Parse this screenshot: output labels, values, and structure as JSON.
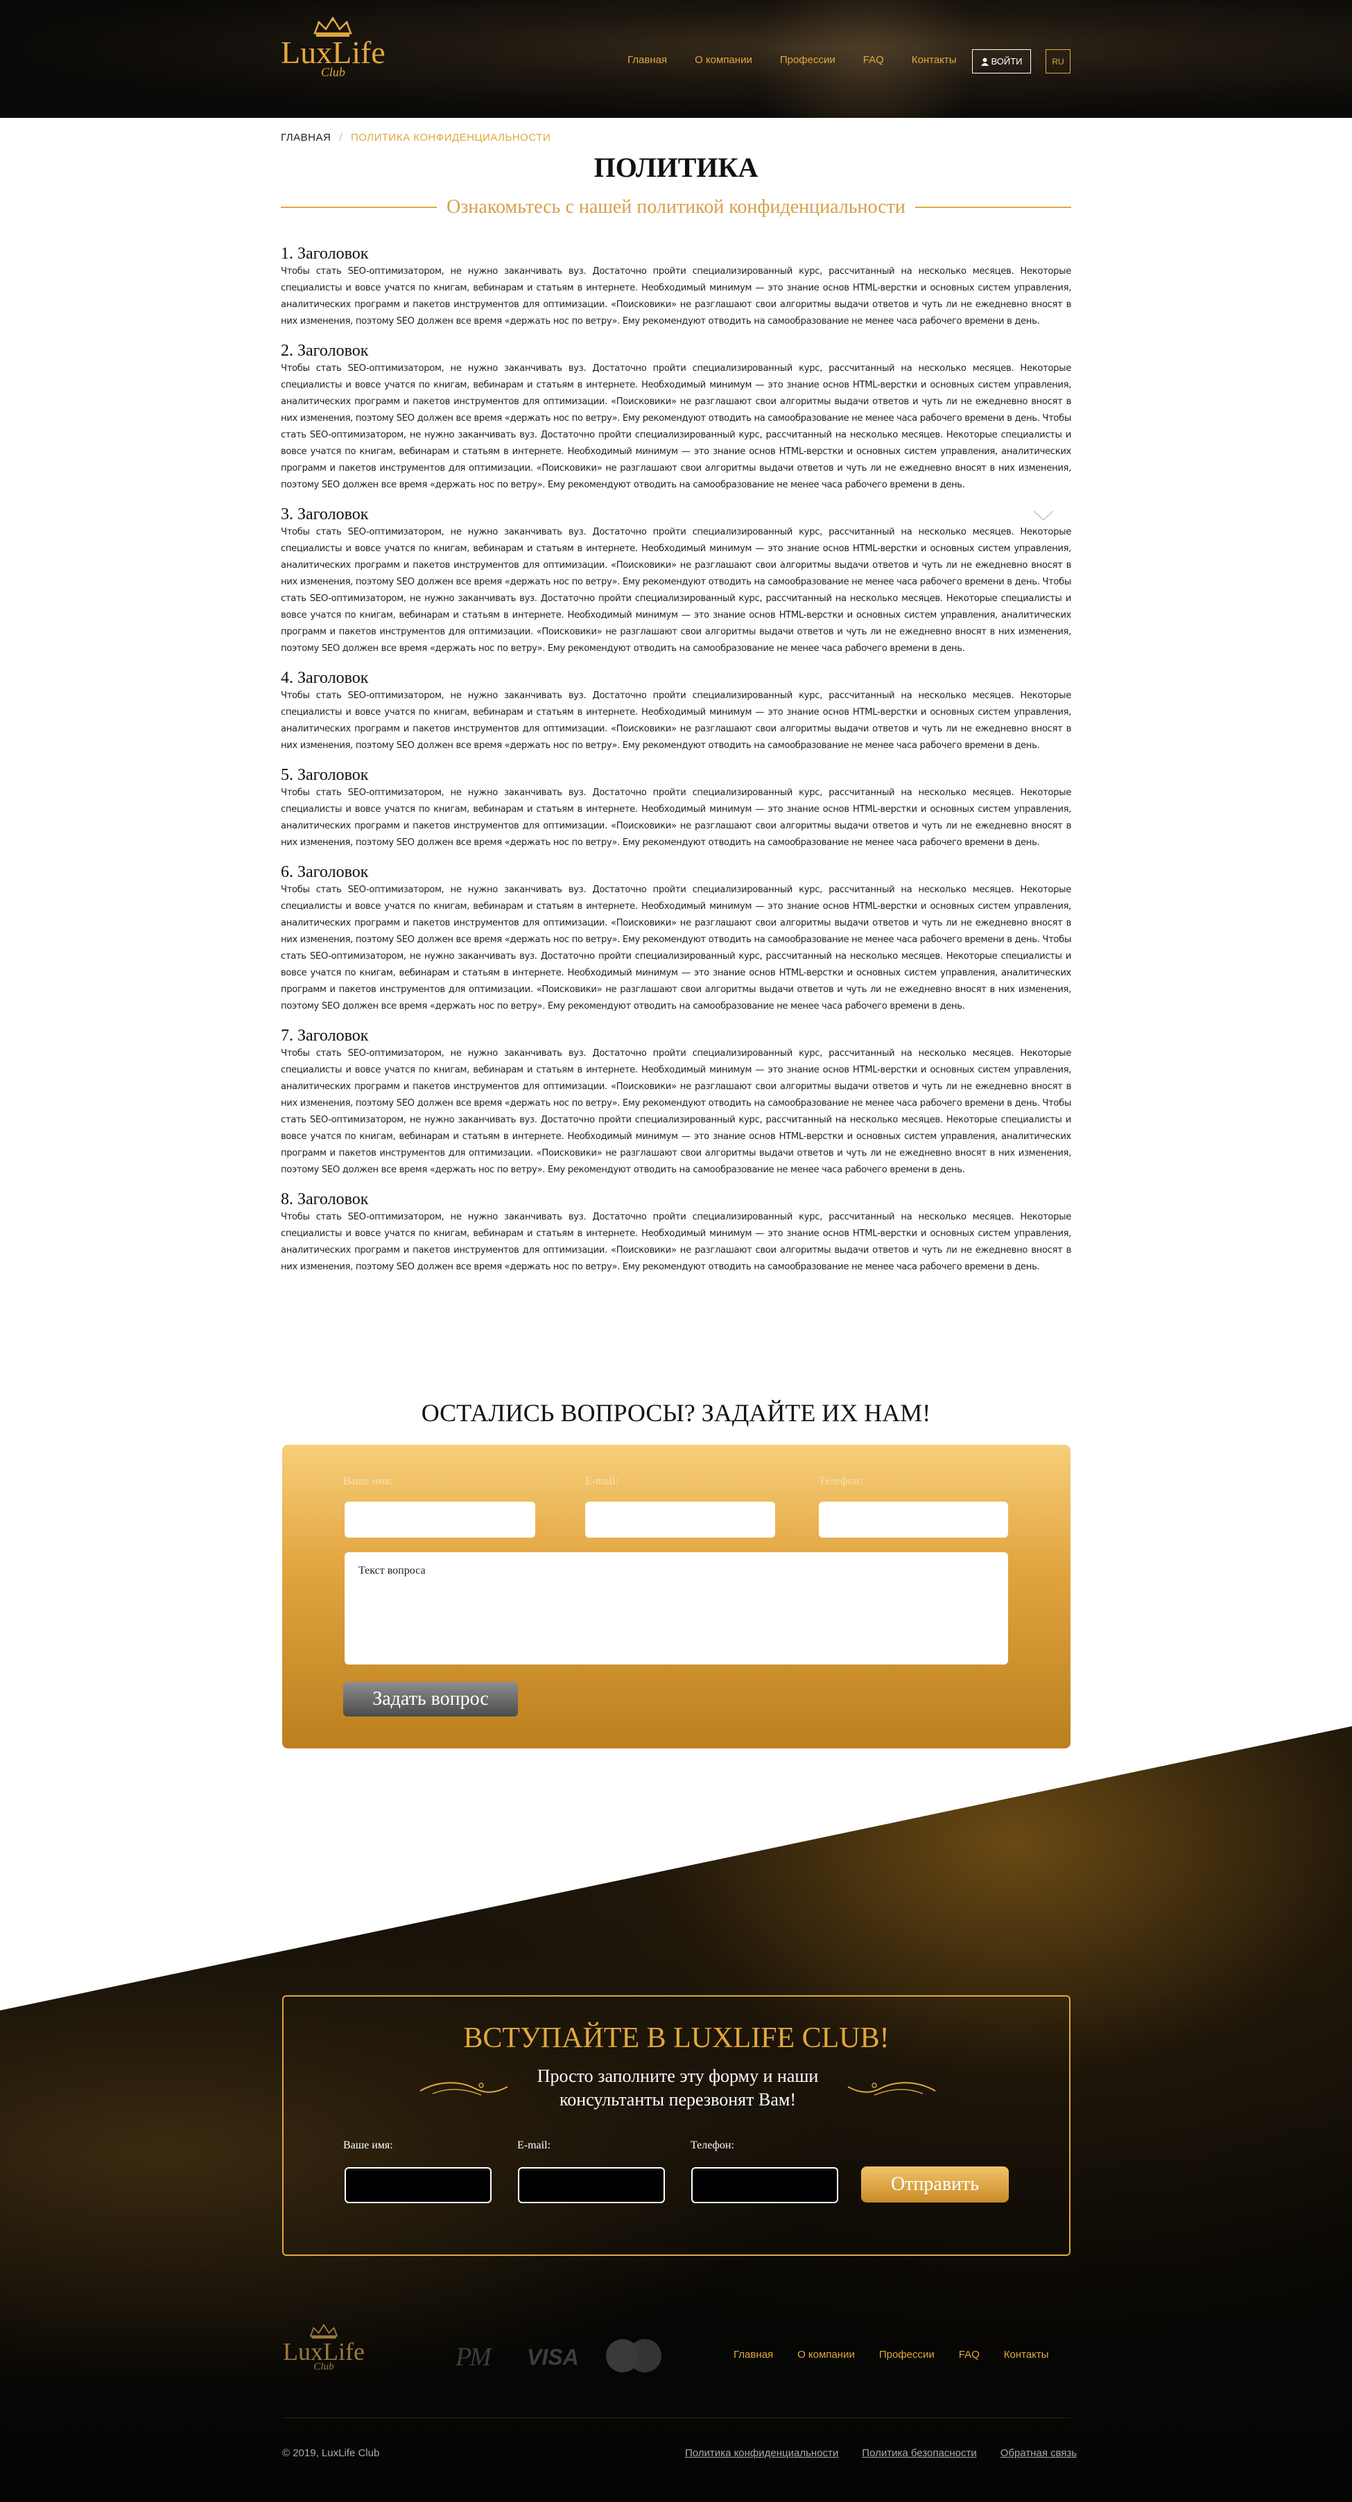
{
  "header": {
    "logo_word": "LuxLife",
    "logo_sub": "Club",
    "nav": [
      "Главная",
      "О компании",
      "Профессии",
      "FAQ",
      "Контакты"
    ],
    "login_label": "ВОЙТИ",
    "lang_label": "RU"
  },
  "breadcrumb": {
    "home": "ГЛАВНАЯ",
    "separator": "/",
    "current": "ПОЛИТИКА КОНФИДЕНЦИАЛЬНОСТИ"
  },
  "page": {
    "title": "ПОЛИТИКА",
    "subtitle": "Ознакомьтесь с нашей политикой конфиденциальности"
  },
  "sections": [
    {
      "heading": "1. Заголовок",
      "text": "Чтобы стать SEO-оптимизатором, не нужно заканчивать вуз. Достаточно пройти специализированный курс, рассчитанный на несколько месяцев. Некоторые специалисты и вовсе учатся по книгам, вебинарам и статьям в интернете. Необходимый минимум — это знание основ HTML-верстки и основных систем управления, аналитических программ и пакетов инструментов для оптимизации. «Поисковики» не разглашают свои алгоритмы выдачи ответов и чуть ли не ежедневно вносят в них изменения, поэтому SEO должен все время «держать нос по ветру». Ему рекомендуют отводить на самообразование не менее часа рабочего времени в день."
    },
    {
      "heading": "2. Заголовок",
      "text": "Чтобы стать SEO-оптимизатором, не нужно заканчивать вуз. Достаточно пройти специализированный курс, рассчитанный на несколько месяцев. Некоторые специалисты и вовсе учатся по книгам, вебинарам и статьям в интернете. Необходимый минимум — это знание основ HTML-верстки и основных систем управления, аналитических программ и пакетов инструментов для оптимизации. «Поисковики» не разглашают свои алгоритмы выдачи ответов и чуть ли не ежедневно вносят в них изменения, поэтому SEO должен все время «держать нос по ветру». Ему рекомендуют отводить на самообразование не менее часа рабочего времени в день. Чтобы стать SEO-оптимизатором, не нужно заканчивать вуз. Достаточно пройти специализированный курс, рассчитанный на несколько месяцев. Некоторые специалисты и вовсе учатся по книгам, вебинарам и статьям в интернете. Необходимый минимум — это знание основ HTML-верстки и основных систем управления, аналитических программ и пакетов инструментов для оптимизации. «Поисковики» не разглашают свои алгоритмы выдачи ответов и чуть ли не ежедневно вносят в них изменения, поэтому SEO должен все время «держать нос по ветру». Ему рекомендуют отводить на самообразование не менее часа рабочего времени в день."
    },
    {
      "heading": "3. Заголовок",
      "text": "Чтобы стать SEO-оптимизатором, не нужно заканчивать вуз. Достаточно пройти специализированный курс, рассчитанный на несколько месяцев. Некоторые специалисты и вовсе учатся по книгам, вебинарам и статьям в интернете. Необходимый минимум — это знание основ HTML-верстки и основных систем управления, аналитических программ и пакетов инструментов для оптимизации. «Поисковики» не разглашают свои алгоритмы выдачи ответов и чуть ли не ежедневно вносят в них изменения, поэтому SEO должен все время «держать нос по ветру». Ему рекомендуют отводить на самообразование не менее часа рабочего времени в день. Чтобы стать SEO-оптимизатором, не нужно заканчивать вуз. Достаточно пройти специализированный курс, рассчитанный на несколько месяцев. Некоторые специалисты и вовсе учатся по книгам, вебинарам и статьям в интернете. Необходимый минимум — это знание основ HTML-верстки и основных систем управления, аналитических программ и пакетов инструментов для оптимизации. «Поисковики» не разглашают свои алгоритмы выдачи ответов и чуть ли не ежедневно вносят в них изменения, поэтому SEO должен все время «держать нос по ветру». Ему рекомендуют отводить на самообразование не менее часа рабочего времени в день."
    },
    {
      "heading": "4. Заголовок",
      "text": "Чтобы стать SEO-оптимизатором, не нужно заканчивать вуз. Достаточно пройти специализированный курс, рассчитанный на несколько месяцев. Некоторые специалисты и вовсе учатся по книгам, вебинарам и статьям в интернете. Необходимый минимум — это знание основ HTML-верстки и основных систем управления, аналитических программ и пакетов инструментов для оптимизации. «Поисковики» не разглашают свои алгоритмы выдачи ответов и чуть ли не ежедневно вносят в них изменения, поэтому SEO должен все время «держать нос по ветру». Ему рекомендуют отводить на самообразование не менее часа рабочего времени в день."
    },
    {
      "heading": "5. Заголовок",
      "text": "Чтобы стать SEO-оптимизатором, не нужно заканчивать вуз. Достаточно пройти специализированный курс, рассчитанный на несколько месяцев. Некоторые специалисты и вовсе учатся по книгам, вебинарам и статьям в интернете. Необходимый минимум — это знание основ HTML-верстки и основных систем управления, аналитических программ и пакетов инструментов для оптимизации. «Поисковики» не разглашают свои алгоритмы выдачи ответов и чуть ли не ежедневно вносят в них изменения, поэтому SEO должен все время «держать нос по ветру». Ему рекомендуют отводить на самообразование не менее часа рабочего времени в день."
    },
    {
      "heading": "6. Заголовок",
      "text": "Чтобы стать SEO-оптимизатором, не нужно заканчивать вуз. Достаточно пройти специализированный курс, рассчитанный на несколько месяцев. Некоторые специалисты и вовсе учатся по книгам, вебинарам и статьям в интернете. Необходимый минимум — это знание основ HTML-верстки и основных систем управления, аналитических программ и пакетов инструментов для оптимизации. «Поисковики» не разглашают свои алгоритмы выдачи ответов и чуть ли не ежедневно вносят в них изменения, поэтому SEO должен все время «держать нос по ветру». Ему рекомендуют отводить на самообразование не менее часа рабочего времени в день. Чтобы стать SEO-оптимизатором, не нужно заканчивать вуз. Достаточно пройти специализированный курс, рассчитанный на несколько месяцев. Некоторые специалисты и вовсе учатся по книгам, вебинарам и статьям в интернете. Необходимый минимум — это знание основ HTML-верстки и основных систем управления, аналитических программ и пакетов инструментов для оптимизации. «Поисковики» не разглашают свои алгоритмы выдачи ответов и чуть ли не ежедневно вносят в них изменения, поэтому SEO должен все время «держать нос по ветру». Ему рекомендуют отводить на самообразование не менее часа рабочего времени в день."
    },
    {
      "heading": "7. Заголовок",
      "text": "Чтобы стать SEO-оптимизатором, не нужно заканчивать вуз. Достаточно пройти специализированный курс, рассчитанный на несколько месяцев. Некоторые специалисты и вовсе учатся по книгам, вебинарам и статьям в интернете. Необходимый минимум — это знание основ HTML-верстки и основных систем управления, аналитических программ и пакетов инструментов для оптимизации. «Поисковики» не разглашают свои алгоритмы выдачи ответов и чуть ли не ежедневно вносят в них изменения, поэтому SEO должен все время «держать нос по ветру». Ему рекомендуют отводить на самообразование не менее часа рабочего времени в день. Чтобы стать SEO-оптимизатором, не нужно заканчивать вуз. Достаточно пройти специализированный курс, рассчитанный на несколько месяцев. Некоторые специалисты и вовсе учатся по книгам, вебинарам и статьям в интернете. Необходимый минимум — это знание основ HTML-верстки и основных систем управления, аналитических программ и пакетов инструментов для оптимизации. «Поисковики» не разглашают свои алгоритмы выдачи ответов и чуть ли не ежедневно вносят в них изменения, поэтому SEO должен все время «держать нос по ветру». Ему рекомендуют отводить на самообразование не менее часа рабочего времени в день."
    },
    {
      "heading": "8. Заголовок",
      "text": "Чтобы стать SEO-оптимизатором, не нужно заканчивать вуз. Достаточно пройти специализированный курс, рассчитанный на несколько месяцев. Некоторые специалисты и вовсе учатся по книгам, вебинарам и статьям в интернете. Необходимый минимум — это знание основ HTML-верстки и основных систем управления, аналитических программ и пакетов инструментов для оптимизации. «Поисковики» не разглашают свои алгоритмы выдачи ответов и чуть ли не ежедневно вносят в них изменения, поэтому SEO должен все время «держать нос по ветру». Ему рекомендуют отводить на самообразование не менее часа рабочего времени в день."
    }
  ],
  "question_form": {
    "title": "ОСТАЛИСЬ ВОПРОСЫ? ЗАДАЙТЕ ИХ НАМ!",
    "name_label": "Ваше имя:",
    "email_label": "E-mail:",
    "phone_label": "Телефон:",
    "question_placeholder": "Текст вопроса",
    "submit_label": "Задать вопрос"
  },
  "join_form": {
    "title": "ВСТУПАЙТЕ В LUXLIFE CLUB!",
    "subtitle": "Просто заполните эту форму и наши консультанты перезвонят Вам!",
    "name_label": "Ваше имя:",
    "email_label": "E-mail:",
    "phone_label": "Телефон:",
    "submit_label": "Отправить"
  },
  "footer": {
    "logo_word": "LuxLife",
    "logo_sub": "Club",
    "payments": {
      "pm": "PM",
      "visa": "VISA"
    },
    "nav": [
      "Главная",
      "О компании",
      "Профессии",
      "FAQ",
      "Контакты"
    ],
    "copyright": "© 2019, LuxLife Club",
    "links": [
      "Политика конфиденциальности",
      "Политика безопасности",
      "Обратная связь"
    ]
  },
  "colors": {
    "gold": "#e0a83e",
    "dark": "#0b0a08",
    "form_gold": "#e2a540"
  },
  "icons": [
    "crown-icon",
    "user-icon",
    "chevron-down-icon",
    "swirl-ornament-icon",
    "mastercard-icon"
  ]
}
